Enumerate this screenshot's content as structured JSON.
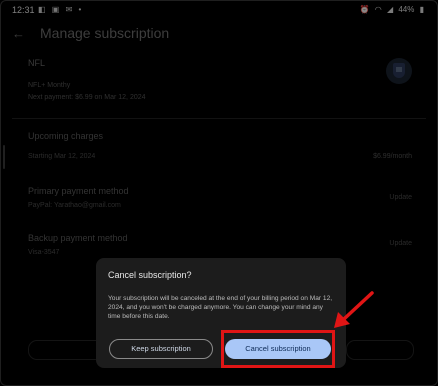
{
  "status_bar": {
    "time": "12:31",
    "left_icons": "◧ ▣ ✉ •",
    "right_icons": [
      "alarm-icon",
      "wifi-icon",
      "signal-icon"
    ],
    "battery": "44%"
  },
  "header": {
    "title": "Manage subscription"
  },
  "subscription": {
    "app_name": "NFL",
    "plan": "NFL+ Monthy",
    "next_payment": "Next payment: $6.99 on Mar 12, 2024"
  },
  "upcoming": {
    "heading": "Upcoming charges",
    "starting": "Starting Mar 12, 2024",
    "amount": "$6.99/month"
  },
  "primary_payment": {
    "heading": "Primary payment method",
    "value": "PayPal: Yarathao@gmail.com",
    "action": "Update"
  },
  "backup_payment": {
    "heading": "Backup payment method",
    "value": "Visa-3547",
    "action": "Update"
  },
  "dialog": {
    "title": "Cancel subscription?",
    "body": "Your subscription will be canceled at the end of your billing period on Mar 12, 2024, and you won't be charged anymore. You can change your mind any time before this date.",
    "keep_label": "Keep subscription",
    "cancel_label": "Cancel subscription"
  },
  "colors": {
    "accent_button": "#a9c7f7",
    "highlight": "#e01515"
  }
}
